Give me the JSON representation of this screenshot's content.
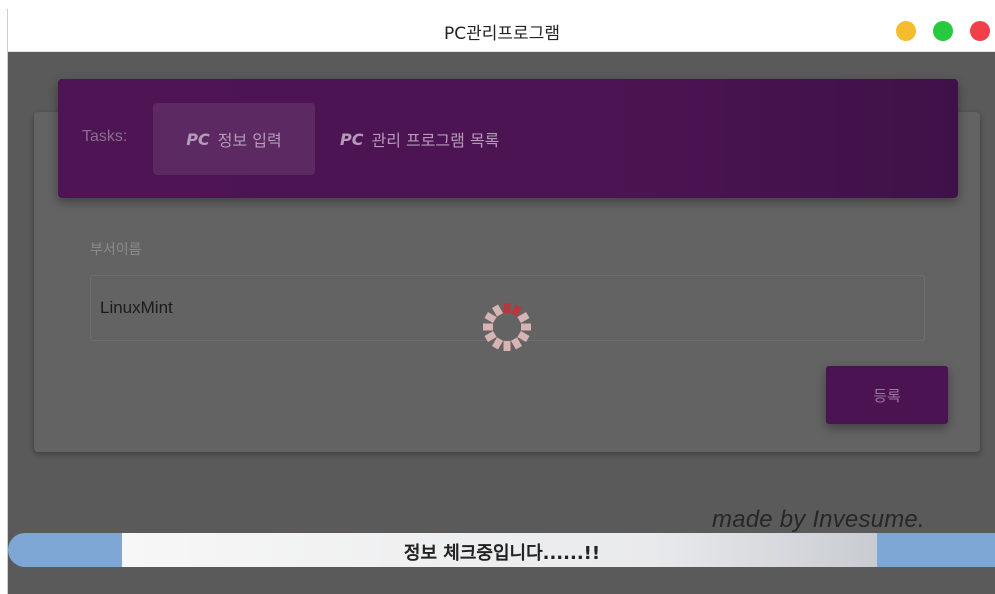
{
  "window": {
    "title": "PC관리프로그램",
    "controls": {
      "minimize_color": "#f6bc2f",
      "maximize_color": "#27c93f",
      "close_color": "#f1404a"
    }
  },
  "tabs": {
    "label": "Tasks:",
    "items": [
      {
        "prefix": "PC",
        "label": "정보 입력",
        "active": true
      },
      {
        "prefix": "PC",
        "label": "관리 프로그램 목록",
        "active": false
      }
    ]
  },
  "form": {
    "department_label": "부서이름",
    "department_value": "LinuxMint",
    "submit_label": "등록"
  },
  "footer": {
    "credit": "made by Invesume.",
    "status_text": "정보 체크중입니다......!!",
    "progress_fraction": 0.88
  },
  "loading_spinner": {
    "icon": "spinner-icon",
    "visible": true
  },
  "colors": {
    "accent": "#4e1454",
    "overlay": "#5a5a5a",
    "progress": "#7fa7d6"
  }
}
